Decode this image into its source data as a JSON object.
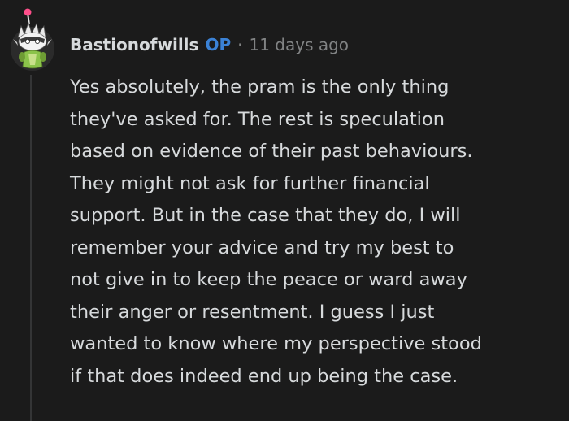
{
  "comment": {
    "author": "Bastionofwills",
    "badge": "OP",
    "separator": "·",
    "timestamp": "11 days ago",
    "body_lines": [
      "Yes absolutely, the pram is the only thing",
      "they've asked for. The rest is speculation",
      "based on evidence of their past behaviours.",
      "They might not ask for further financial",
      "support. But in the case that they do, I will",
      "remember your advice and try my best to",
      "not give in to keep the peace or ward away",
      "their anger or resentment. I guess I just",
      "wanted to know where my perspective stood",
      "if that does indeed end up being the case."
    ]
  },
  "colors": {
    "background": "#1b1b1b",
    "text": "#d7dadc",
    "meta": "#818384",
    "op_badge": "#3b82d6",
    "thread_line": "#343536",
    "avatar_antenna": "#ff4f8b",
    "avatar_accent": "#8bc34a"
  },
  "icons": {
    "avatar": "snoo-avatar-icon"
  }
}
